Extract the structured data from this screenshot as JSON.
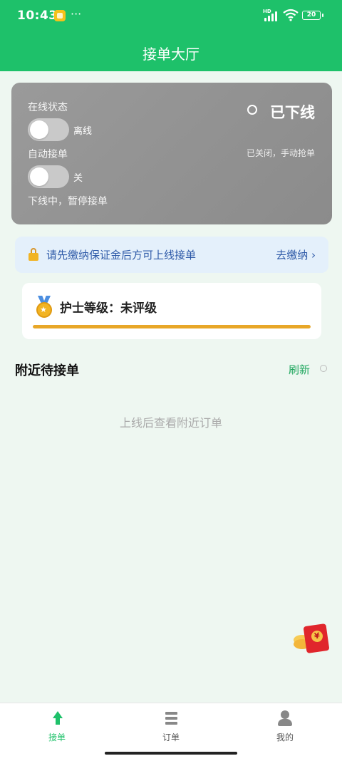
{
  "status_bar": {
    "time": "10:43",
    "more": "···",
    "network": "HD",
    "battery": "20"
  },
  "header": {
    "title": "接单大厅"
  },
  "status_card": {
    "online_label": "在线状态",
    "online_toggle_text": "离线",
    "auto_label": "自动接单",
    "auto_toggle_text": "关",
    "status_note": "下线中，暂停接单",
    "state_text": "已下线",
    "auto_note": "已关闭，手动抢单"
  },
  "deposit_banner": {
    "text": "请先缴纳保证金后方可上线接单",
    "action": "去缴纳 ›"
  },
  "level_card": {
    "text": "护士等级：未评级",
    "progress": 1.0,
    "accent": "#e8a728"
  },
  "nearby": {
    "title": "附近待接单",
    "refresh": "刷新",
    "empty": "上线后查看附近订单"
  },
  "tabbar": {
    "items": [
      {
        "label": "接单",
        "icon": "arrow-up-icon",
        "active": true
      },
      {
        "label": "订单",
        "icon": "list-icon",
        "active": false
      },
      {
        "label": "我的",
        "icon": "person-icon",
        "active": false
      }
    ]
  },
  "colors": {
    "brand": "#1ec16a",
    "link": "#2e5aa8"
  }
}
